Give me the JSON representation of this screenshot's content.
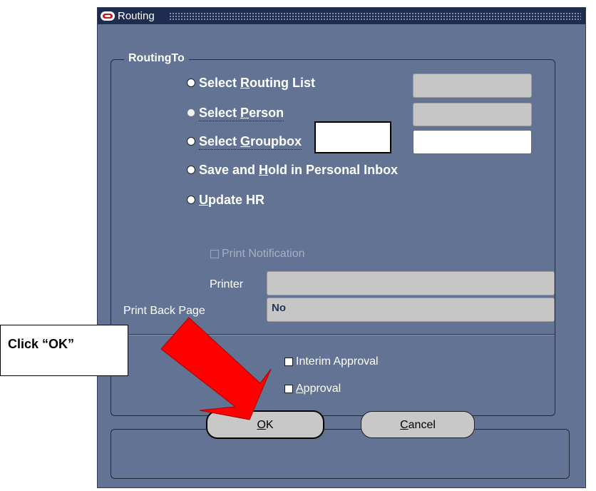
{
  "window": {
    "title": "Routing"
  },
  "routing_group": {
    "legend": "RoutingTo",
    "options": [
      {
        "pre": "Select ",
        "mn": "R",
        "post": "outing List"
      },
      {
        "pre": "Select ",
        "mn": "P",
        "post": "erson"
      },
      {
        "pre": "Select ",
        "mn": "G",
        "post": "roupbox"
      },
      {
        "pre": "Save and ",
        "mn": "H",
        "post": "old in Personal Inbox"
      },
      {
        "pre": "",
        "mn": "U",
        "post": "pdate HR"
      }
    ],
    "print_notification": "Print Notification",
    "printer_label": "Printer",
    "printer_value": "",
    "back_page_label": "Print Back Page",
    "back_page_value": "No",
    "interim_approval": "Interim Approval",
    "approval": {
      "mn": "A",
      "post": "pproval"
    }
  },
  "buttons": {
    "ok": {
      "mn": "O",
      "post": "K"
    },
    "cancel": {
      "mn": "C",
      "post": "ancel"
    }
  },
  "annotation": {
    "callout": "Click “OK”",
    "arrow_color": "#ff0000"
  }
}
